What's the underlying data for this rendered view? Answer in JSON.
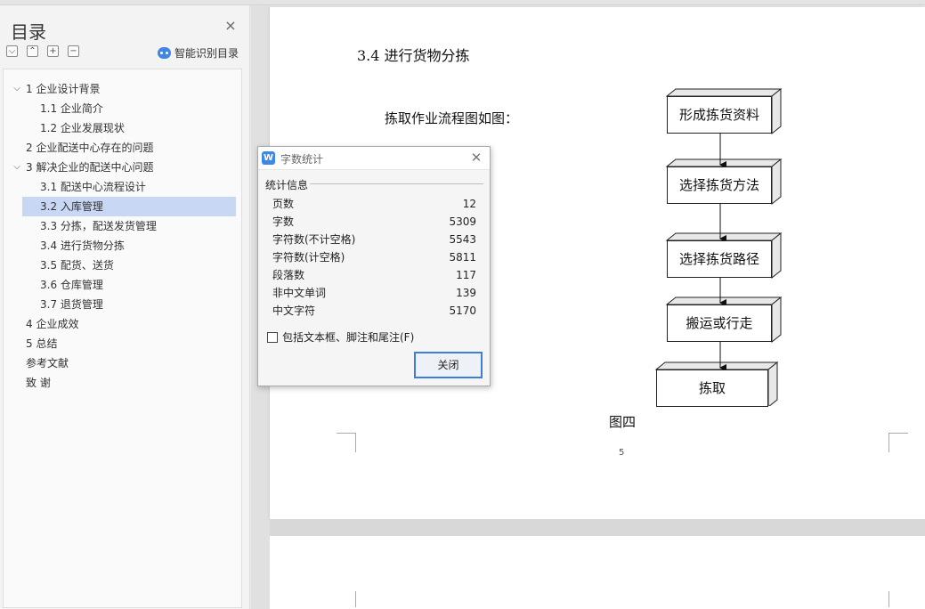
{
  "sidebar": {
    "title": "目录",
    "close_icon": "×",
    "tools": [
      "⌵",
      "⌃",
      "+",
      "−"
    ],
    "smart_label": "智能识别目录",
    "toc": [
      {
        "label": "1 企业设计背景",
        "level": 1,
        "expanded": true
      },
      {
        "label": "1.1 企业简介",
        "level": 2
      },
      {
        "label": "1.2 企业发展现状",
        "level": 2
      },
      {
        "label": "2 企业配送中心存在的问题",
        "level": 1
      },
      {
        "label": "3 解决企业的配送中心问题",
        "level": 1,
        "expanded": true
      },
      {
        "label": "3.1  配送中心流程设计",
        "level": 2
      },
      {
        "label": "3.2  入库管理",
        "level": 2,
        "selected": true
      },
      {
        "label": "3.3  分拣，配送发货管理",
        "level": 2
      },
      {
        "label": "3.4  进行货物分拣",
        "level": 2
      },
      {
        "label": "3.5  配货、送货",
        "level": 2
      },
      {
        "label": "3.6  仓库管理",
        "level": 2
      },
      {
        "label": "3.7  退货管理",
        "level": 2
      },
      {
        "label": "4 企业成效",
        "level": 1
      },
      {
        "label": "5 总结",
        "level": 1
      },
      {
        "label": "参考文献",
        "level": 1
      },
      {
        "label": "致    谢",
        "level": 1
      }
    ]
  },
  "document": {
    "heading": "3.4  进行货物分拣",
    "intro": "拣取作业流程图如图：",
    "figure_caption": "图四",
    "page_number": "5",
    "flow_steps": [
      "形成拣货资料",
      "选择拣货方法",
      "选择拣货路径",
      "搬运或行走",
      "拣取"
    ]
  },
  "dialog": {
    "title": "字数统计",
    "logo": "W",
    "close_icon": "✕",
    "group_label": "统计信息",
    "stats": [
      {
        "label": "页数",
        "value": "12"
      },
      {
        "label": "字数",
        "value": "5309"
      },
      {
        "label": "字符数(不计空格)",
        "value": "5543"
      },
      {
        "label": "字符数(计空格)",
        "value": "5811"
      },
      {
        "label": "段落数",
        "value": "117"
      },
      {
        "label": "非中文单词",
        "value": "139"
      },
      {
        "label": "中文字符",
        "value": "5170"
      }
    ],
    "checkbox_label": "包括文本框、脚注和尾注(F)",
    "checkbox_checked": false,
    "close_button": "关闭"
  }
}
